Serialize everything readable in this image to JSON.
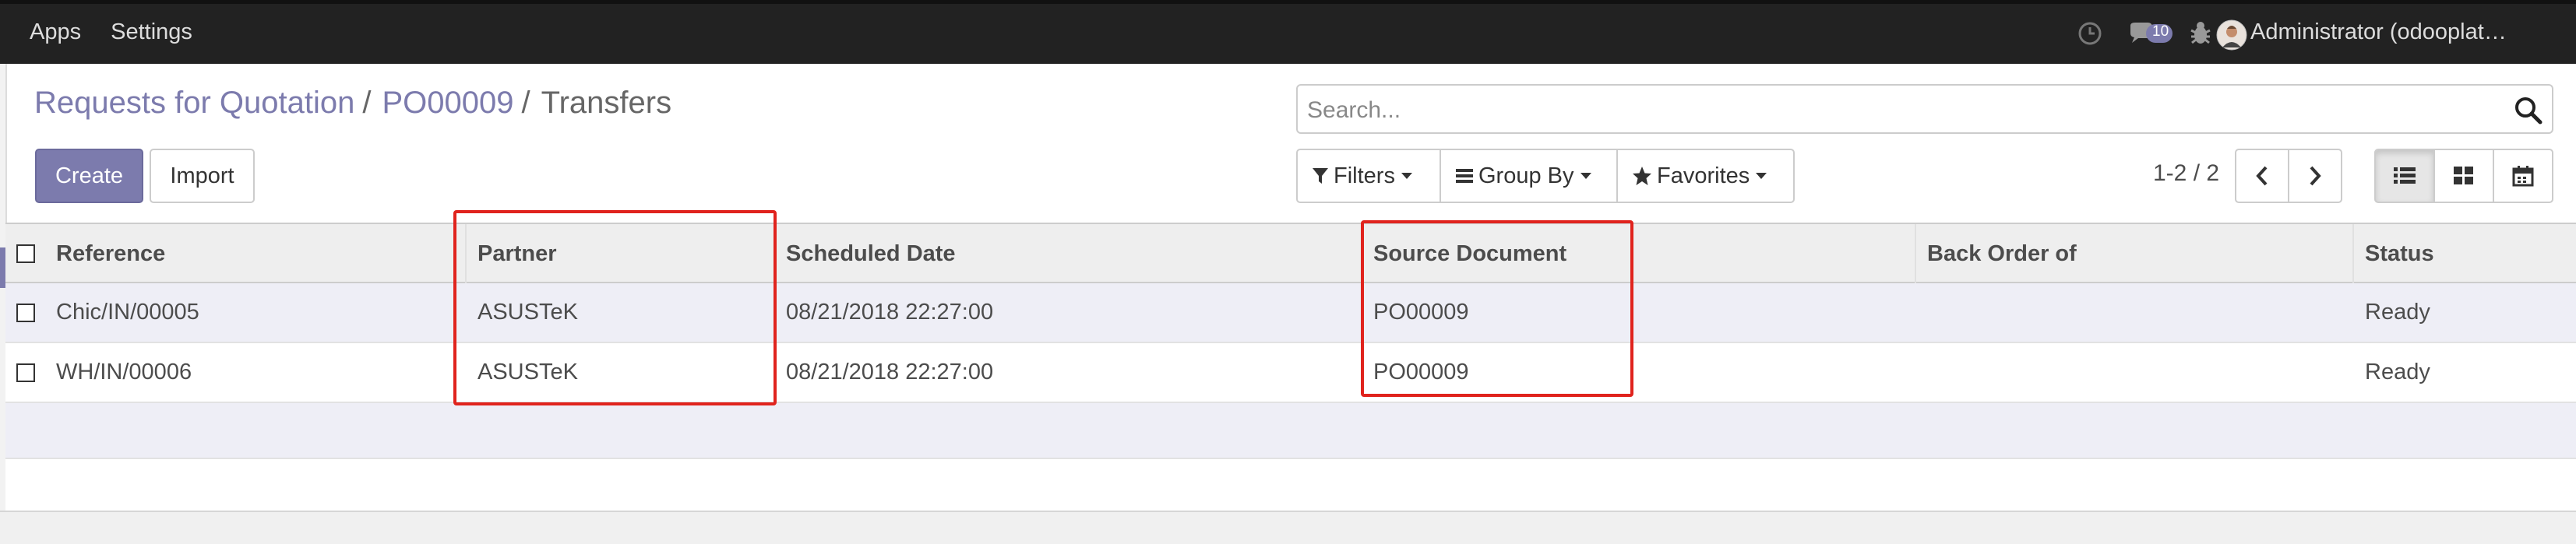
{
  "navbar": {
    "menu": [
      "Apps",
      "Settings"
    ],
    "messages_count": "10",
    "user_label": "Administrator (odooplat…"
  },
  "breadcrumb": {
    "items": [
      "Requests for Quotation",
      "PO00009"
    ],
    "active": "Transfers"
  },
  "actions": {
    "create_label": "Create",
    "import_label": "Import"
  },
  "search": {
    "placeholder": "Search..."
  },
  "filters": {
    "filters_label": "Filters",
    "groupby_label": "Group By",
    "favorites_label": "Favorites"
  },
  "pager": {
    "value": "1-2 / 2"
  },
  "table": {
    "columns": [
      "Reference",
      "Partner",
      "Scheduled Date",
      "Source Document",
      "Back Order of",
      "Status"
    ],
    "rows": [
      {
        "reference": "Chic/IN/00005",
        "partner": "ASUSTeK",
        "scheduled_date": "08/21/2018 22:27:00",
        "source_document": "PO00009",
        "back_order_of": "",
        "status": "Ready"
      },
      {
        "reference": "WH/IN/00006",
        "partner": "ASUSTeK",
        "scheduled_date": "08/21/2018 22:27:00",
        "source_document": "PO00009",
        "back_order_of": "",
        "status": "Ready"
      }
    ]
  },
  "colors": {
    "brand": "#7c7bad",
    "navbar": "#222222",
    "highlight": "#e0231d",
    "badge": "#7c7bad"
  },
  "icons": [
    "clock-icon",
    "chat-icon",
    "bug-icon",
    "avatar",
    "search-icon",
    "filter-icon",
    "list-icon",
    "star-icon",
    "chevron-left-icon",
    "chevron-right-icon",
    "list-view-icon",
    "kanban-view-icon",
    "calendar-view-icon"
  ]
}
